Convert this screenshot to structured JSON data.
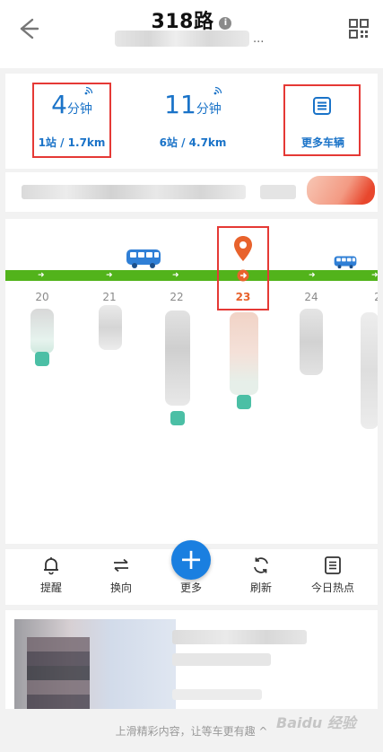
{
  "header": {
    "title": "318路",
    "info_icon": "info-icon",
    "subtitle_suffix": "...",
    "back_icon": "back-arrow-icon",
    "qr_icon": "qr-code-icon"
  },
  "arrivals": [
    {
      "number": "4",
      "unit": "分钟",
      "detail": "1站 / 1.7km",
      "highlighted": true
    },
    {
      "number": "11",
      "unit": "分钟",
      "detail": "6站 / 4.7km",
      "highlighted": false
    }
  ],
  "more_vehicles": {
    "label": "更多车辆",
    "icon": "list-icon"
  },
  "stations": [
    {
      "number": "20"
    },
    {
      "number": "21"
    },
    {
      "number": "22"
    },
    {
      "number": "23",
      "current": true
    },
    {
      "number": "24"
    },
    {
      "number": "2"
    }
  ],
  "toolbar": {
    "items": [
      {
        "label": "提醒",
        "icon": "bell-icon"
      },
      {
        "label": "换向",
        "icon": "swap-icon"
      },
      {
        "label": "更多",
        "icon": "plus-icon"
      },
      {
        "label": "刷新",
        "icon": "refresh-icon"
      },
      {
        "label": "今日热点",
        "icon": "news-icon"
      }
    ]
  },
  "footer": {
    "text": "上滑精彩内容，让等车更有趣 ^"
  },
  "watermark": {
    "text": "Baidu 经验"
  },
  "colors": {
    "primary_blue": "#1a73c8",
    "route_green": "#52b31b",
    "current_station_orange": "#e8622c",
    "highlight_red": "#e53935"
  }
}
